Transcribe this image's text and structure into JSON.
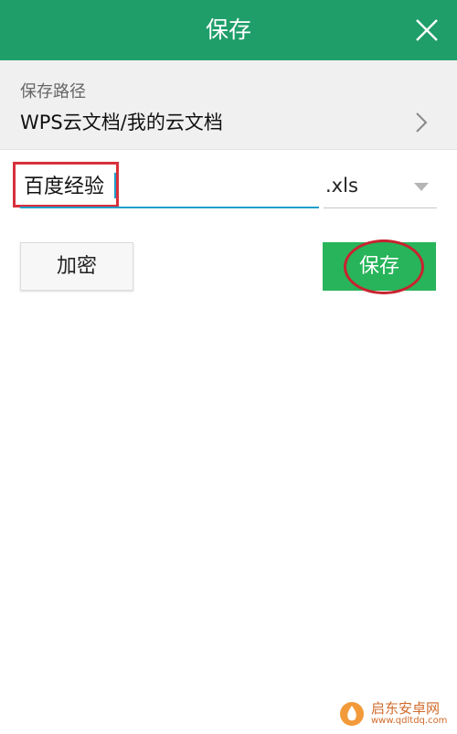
{
  "header": {
    "title": "保存",
    "close_icon": "close-icon"
  },
  "save_path": {
    "label": "保存路径",
    "value": "WPS云文档/我的云文档",
    "chevron_icon": "chevron-right-icon"
  },
  "filename": {
    "value": "百度经验"
  },
  "extension": {
    "selected": ".xls",
    "dropdown_icon": "dropdown-arrow-icon"
  },
  "buttons": {
    "encrypt_label": "加密",
    "save_label": "保存"
  },
  "watermark": {
    "text": "启东安卓网",
    "url": "www.qdltdq.com"
  },
  "colors": {
    "header": "#1f9e6a",
    "save_button": "#27b45a",
    "annotation": "#d8303c",
    "focus_underline": "#1f9ecb"
  }
}
